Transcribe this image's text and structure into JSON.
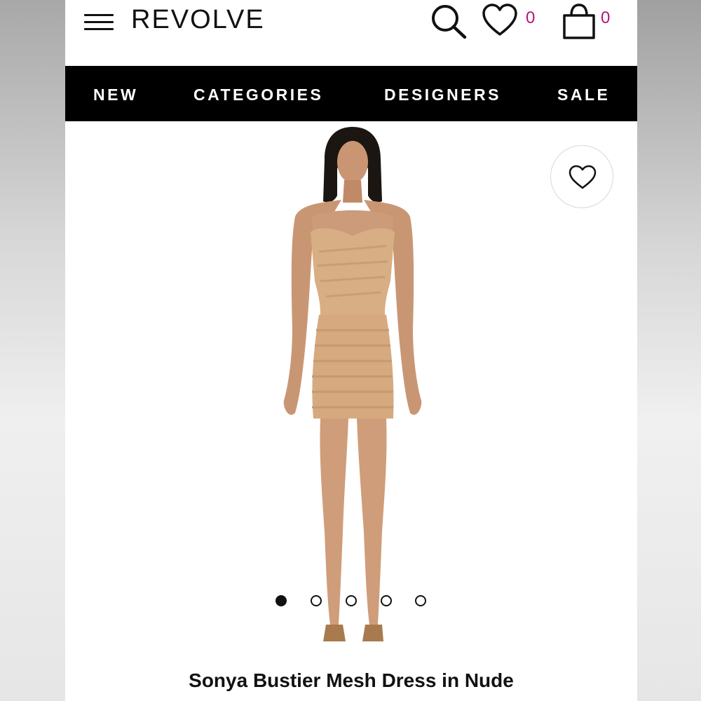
{
  "header": {
    "logo": "REVOLVE",
    "wishlist_count": "0",
    "bag_count": "0",
    "accent_color": "#b5137f"
  },
  "nav": {
    "items": [
      "NEW",
      "CATEGORIES",
      "DESIGNERS",
      "SALE"
    ]
  },
  "product": {
    "title": "Sonya Bustier Mesh Dress in Nude",
    "image_count": 5,
    "active_image": 1
  },
  "icons": {
    "menu": "hamburger-icon",
    "search": "search-icon",
    "wishlist": "heart-icon",
    "bag": "shopping-bag-icon",
    "favorite": "heart-icon"
  }
}
